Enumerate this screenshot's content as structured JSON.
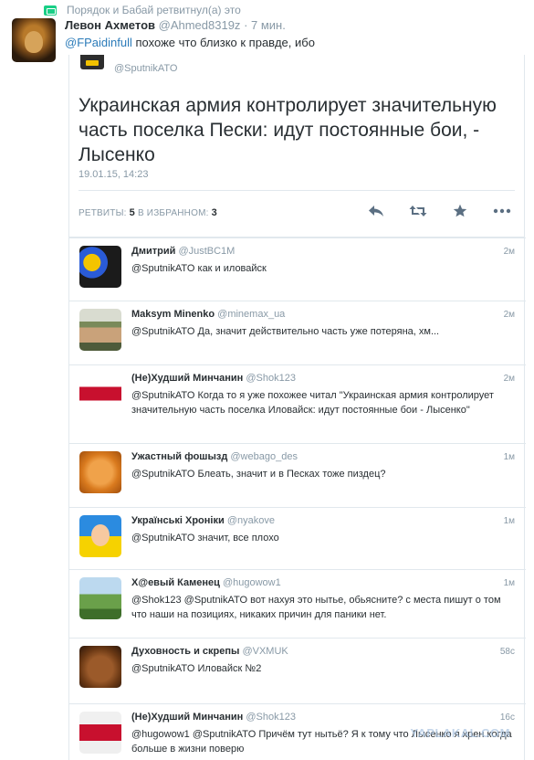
{
  "retweet": {
    "text": "Порядок и Бабай ретвитнул(а) это"
  },
  "outer_tweet": {
    "name": "Левон Ахметов",
    "handle": "@Ahmed8319z",
    "time": "· 7 мин.",
    "mention": "@FPaidinfull",
    "text": " похоже что близко к правде, ибо"
  },
  "quoted": {
    "handle": "@SputnikATO",
    "text": "Украинская армия контролирует значительную часть поселка Пески: идут постоянные бои, - Лысенко",
    "date": "19.01.15, 14:23",
    "retweets_label": "РЕТВИТЫ:",
    "retweets": "5",
    "favorites_label": "В ИЗБРАННОМ:",
    "favorites": "3"
  },
  "replies": [
    {
      "name": "Дмитрий",
      "handle": "@JustBC1M",
      "time": "2м",
      "text": "@SputnikATO как и иловайск"
    },
    {
      "name": "Maksym Minenko",
      "handle": "@minemax_ua",
      "time": "2м",
      "text": "@SputnikATO Да, значит действительно часть уже потеряна, хм..."
    },
    {
      "name": "(Не)Худший Минчанин",
      "handle": "@Shok123",
      "time": "2м",
      "text": "@SputnikATO Когда то я уже похожее читал \"Украинская армия контролирует значительную часть поселка Иловайск: идут постоянные бои - Лысенко\""
    },
    {
      "name": "Ужастный фошызд",
      "handle": "@webago_des",
      "time": "1м",
      "text": "@SputnikATO Блеать, значит и в Песках тоже пиздец?"
    },
    {
      "name": "Українські Хроніки",
      "handle": "@nyakove",
      "time": "1м",
      "text": "@SputnikATO значит, все плохо"
    },
    {
      "name": "Х@евый Каменец",
      "handle": "@hugowow1",
      "time": "1м",
      "text": "@Shok123 @SputnikATO вот нахуя это нытье, обьясните? с места пишут о том что наши на позициях, никаких причин для паники нет."
    },
    {
      "name": "Духовность и скрепы",
      "handle": "@VXMUK",
      "time": "58с",
      "text": "@SputnikATO Иловайск №2"
    },
    {
      "name": "(Не)Худший Минчанин",
      "handle": "@Shok123",
      "time": "16с",
      "text": "@hugowow1 @SputnikATO Причём тут нытьё? Я к тому что Лысенко я хрен когда больше в жизни поверю"
    }
  ],
  "watermark": "YAPLAKAL.COM"
}
